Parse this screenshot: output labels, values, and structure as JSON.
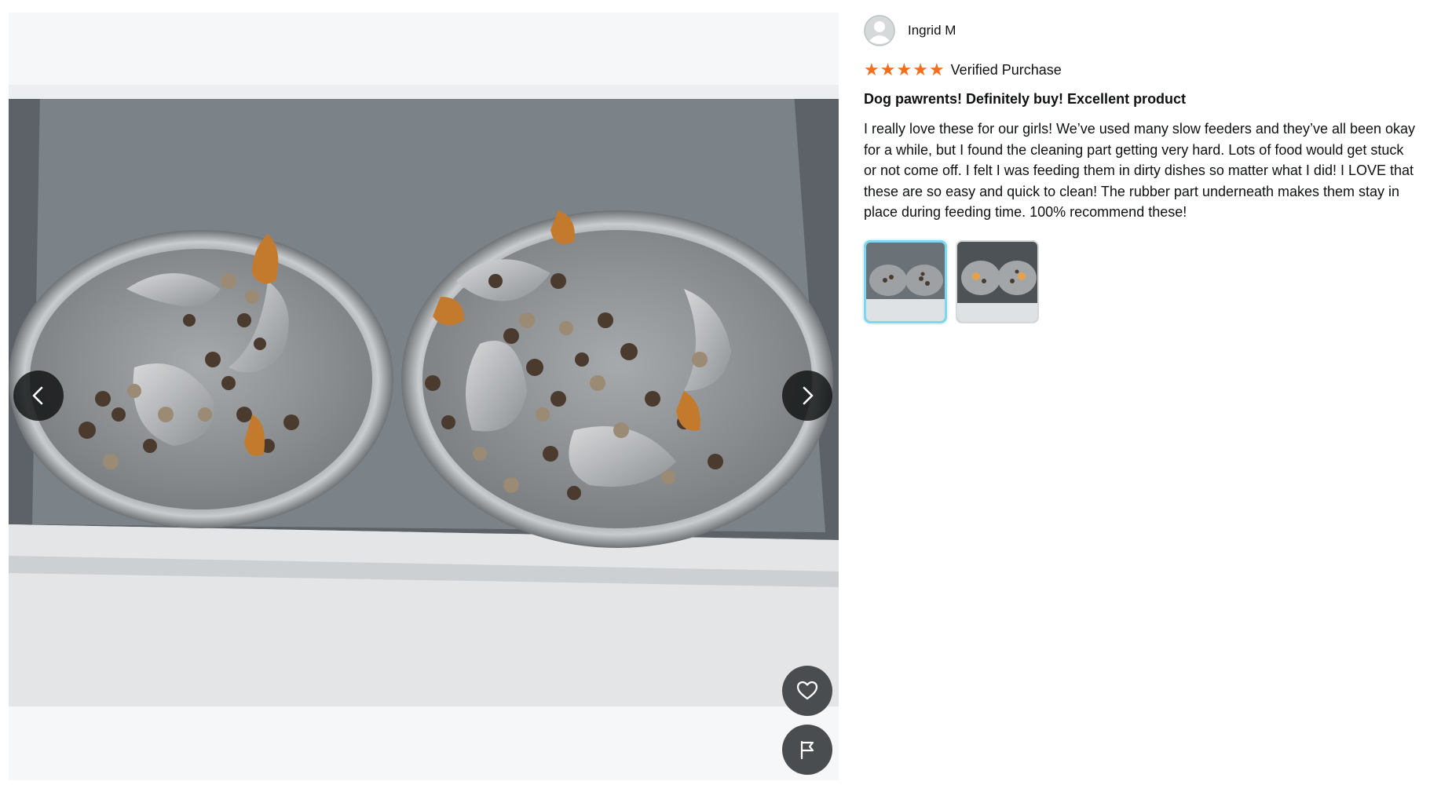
{
  "review": {
    "reviewer_name": "Ingrid M",
    "rating": 5,
    "stars": [
      "★",
      "★",
      "★",
      "★",
      "★"
    ],
    "verified_label": "Verified Purchase",
    "title": "Dog pawrents! Definitely buy! Excellent product",
    "body": "I really love these for our girls! We’ve used many slow feeders and they’ve all been okay for a while, but I found the cleaning part getting very hard. Lots of food would get stuck or not come off. I felt I was feeding them in dirty dishes so matter what I did! I LOVE that these are so easy and quick to clean! The rubber part underneath makes them stay in place during feeding time. 100% recommend these!",
    "thumbnails": [
      {
        "active": true
      },
      {
        "active": false
      }
    ]
  },
  "viewer": {
    "icons": {
      "prev": "chevron-left-icon",
      "next": "chevron-right-icon",
      "like": "heart-icon",
      "report": "flag-icon"
    }
  },
  "colors": {
    "star": "#f36e1d",
    "thumb_active_border": "#7fd6f0",
    "nav_button": "#0f1111",
    "text": "#0f1111"
  }
}
